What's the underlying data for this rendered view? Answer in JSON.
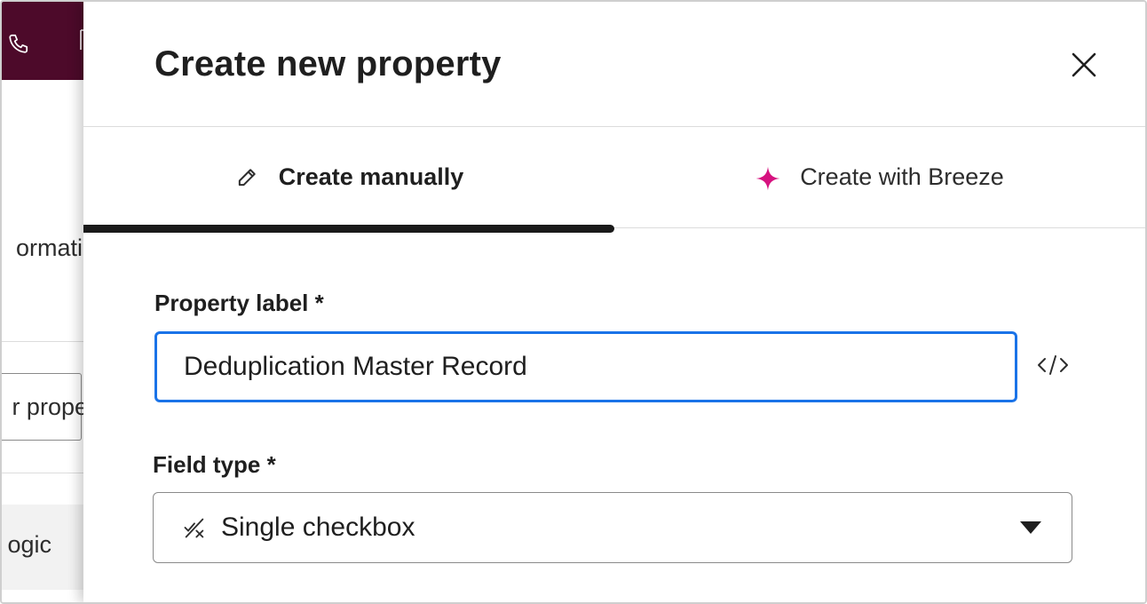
{
  "background": {
    "info_fragment": "ormatio",
    "input_fragment": "r prope",
    "logic_fragment": "ogic"
  },
  "panel": {
    "title": "Create new property",
    "tabs": [
      {
        "label": "Create manually",
        "icon": "pencil-icon",
        "active": true
      },
      {
        "label": "Create with Breeze",
        "icon": "sparkle-icon",
        "active": false
      }
    ]
  },
  "form": {
    "property_label": {
      "label": "Property label *",
      "value": "Deduplication Master Record"
    },
    "field_type": {
      "label": "Field type *",
      "selected": "Single checkbox",
      "icon": "checkbox-type-icon"
    }
  },
  "colors": {
    "brand_dark": "#4d0a2a",
    "focus_blue": "#1a73e8",
    "breeze_magenta": "#d6127f"
  }
}
